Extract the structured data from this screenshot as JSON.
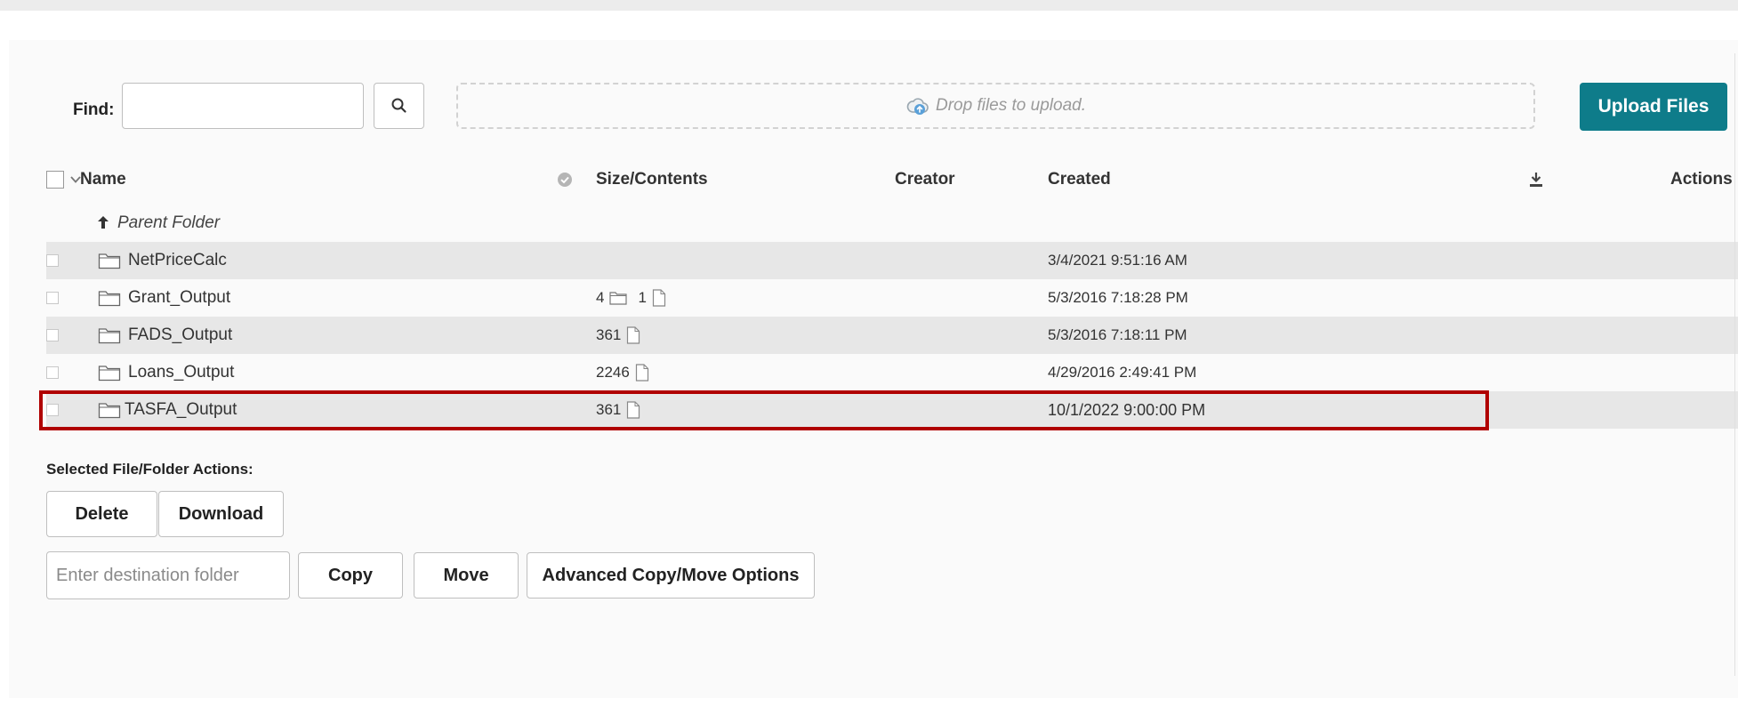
{
  "find": {
    "label": "Find:",
    "value": "",
    "placeholder": ""
  },
  "dropzone": {
    "text": "Drop files to upload."
  },
  "upload_button": "Upload Files",
  "columns": {
    "name": "Name",
    "size": "Size/Contents",
    "creator": "Creator",
    "created": "Created",
    "actions": "Actions"
  },
  "parent_folder": "Parent Folder",
  "rows": [
    {
      "name": "NetPriceCalc",
      "folders": "",
      "files": "",
      "created": "3/4/2021 9:51:16 AM"
    },
    {
      "name": "Grant_Output",
      "folders": "4",
      "files": "1",
      "created": "5/3/2016 7:18:28 PM"
    },
    {
      "name": "FADS_Output",
      "folders": "",
      "files": "361",
      "created": "5/3/2016 7:18:11 PM"
    },
    {
      "name": "Loans_Output",
      "folders": "",
      "files": "2246",
      "created": "4/29/2016 2:49:41 PM"
    },
    {
      "name": "TASFA_Output",
      "folders": "",
      "files": "361",
      "created": "10/1/2022 9:00:00 PM"
    }
  ],
  "selected_actions": {
    "label": "Selected File/Folder Actions:",
    "delete": "Delete",
    "download": "Download",
    "destination_placeholder": "Enter destination folder",
    "copy": "Copy",
    "move": "Move",
    "advanced": "Advanced Copy/Move Options"
  },
  "colors": {
    "upload_button": "#0e7c8a",
    "highlight_border": "#b00000",
    "row_shade": "#e7e7e7"
  }
}
